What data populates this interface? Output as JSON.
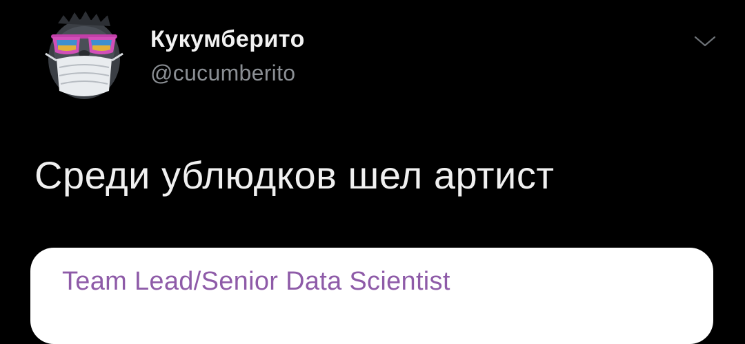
{
  "tweet": {
    "display_name": "Кукумберито",
    "handle": "@cucumberito",
    "text": "Среди ублюдков шел артист",
    "menu_icon": "chevron-down-icon",
    "avatar_icon": "gorilla-mask-sunglasses-avatar"
  },
  "card": {
    "title": "Team Lead/Senior Data Scientist",
    "title_color": "#8e5ba8",
    "background": "#ffffff"
  },
  "colors": {
    "background": "#000000",
    "name": "#f2f2f2",
    "handle": "#8b8f94",
    "text": "#f0f0f0"
  }
}
